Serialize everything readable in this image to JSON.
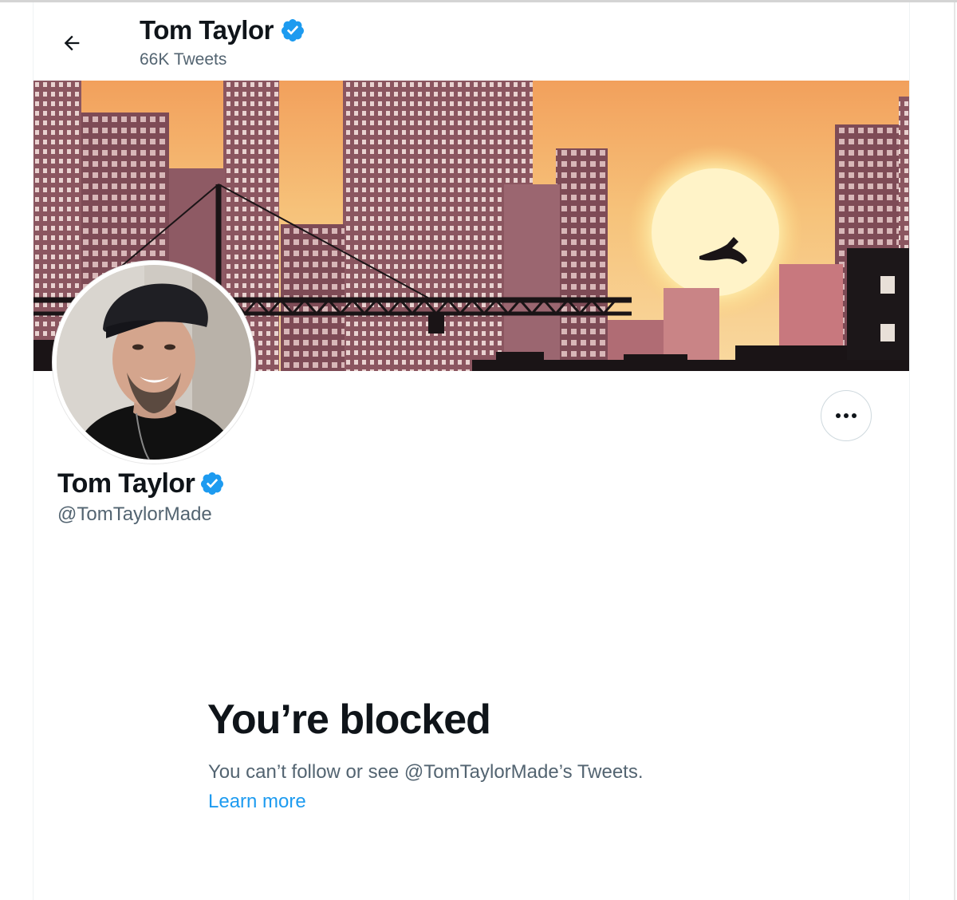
{
  "header": {
    "display_name": "Tom Taylor",
    "tweet_count": "66K Tweets"
  },
  "profile": {
    "display_name": "Tom Taylor",
    "handle": "@TomTaylorMade",
    "verified": true
  },
  "blocked_notice": {
    "title": "You’re blocked",
    "description": "You can’t follow or see @TomTaylorMade’s Tweets.",
    "learn_more_label": "Learn more"
  },
  "icons": {
    "back": "arrow-left-icon",
    "verified": "verified-badge-icon",
    "more": "more-horizontal-icon"
  },
  "colors": {
    "accent": "#1d9bf0",
    "text_primary": "#0f1419",
    "text_secondary": "#536471"
  }
}
